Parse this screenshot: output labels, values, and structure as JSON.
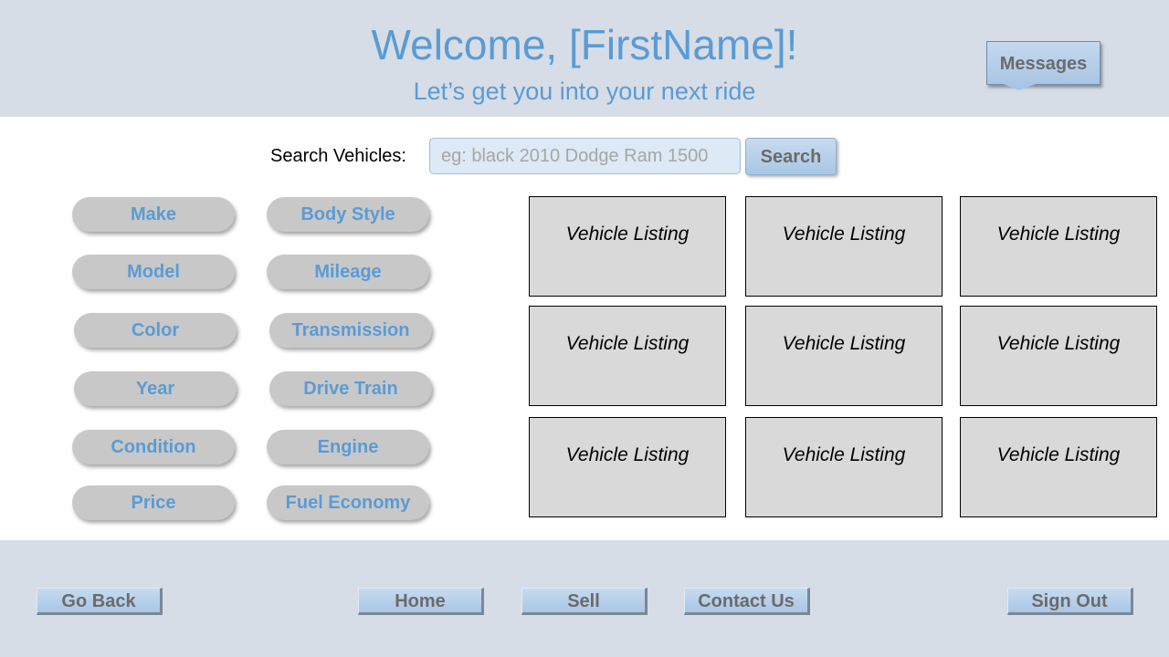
{
  "header": {
    "welcome": "Welcome, [FirstName]!",
    "tagline": "Let’s get you into your next ride",
    "messages_label": "Messages"
  },
  "search": {
    "label": "Search Vehicles:",
    "placeholder": "eg: black 2010 Dodge Ram 1500",
    "value": "",
    "button_label": "Search"
  },
  "filters": [
    "Make",
    "Body Style",
    "Model",
    "Mileage",
    "Color",
    "Transmission",
    "Year",
    "Drive Train",
    "Condition",
    "Engine",
    "Price",
    "Fuel Economy"
  ],
  "listings": [
    "Vehicle Listing",
    "Vehicle Listing",
    "Vehicle Listing",
    "Vehicle Listing",
    "Vehicle Listing",
    "Vehicle Listing",
    "Vehicle Listing",
    "Vehicle Listing",
    "Vehicle Listing"
  ],
  "nav": {
    "go_back": "Go Back",
    "home": "Home",
    "sell": "Sell",
    "contact_us": "Contact Us",
    "sign_out": "Sign Out"
  },
  "colors": {
    "band": "#d6dde6",
    "accent": "#5b9bd5",
    "button": "#a9c6e4",
    "pill": "#c8c8c8",
    "card": "#d9d9d9"
  }
}
